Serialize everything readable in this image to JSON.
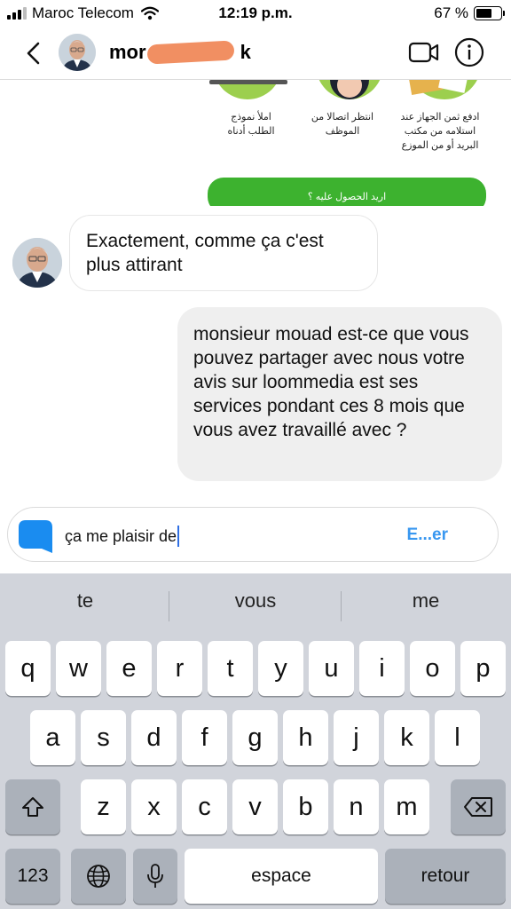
{
  "status_bar": {
    "carrier": "Maroc Telecom",
    "time": "12:19 p.m.",
    "battery": "67 %",
    "battery_level": 0.67
  },
  "header": {
    "username": "mor",
    "username_suffix": "k"
  },
  "shared_image": {
    "captions": [
      "ادفع ثمن الجهاز عند استلامه من مكتب البريد أو من الموزع",
      "انتظر اتصالا من الموظف",
      "املأ نموذج الطلب أدناه"
    ],
    "cta": "اريد الحصول عليه ؟"
  },
  "messages": [
    {
      "direction": "incoming",
      "text": "Exactement, comme ça c'est plus attirant"
    },
    {
      "direction": "outgoing",
      "text": "monsieur mouad est-ce que vous pouvez partager avec nous votre avis sur loommedia est ses services pondant ces 8 mois que vous avez travaillé avec ?"
    }
  ],
  "composer": {
    "value": "ça me plaisir de",
    "send_label": "E...er"
  },
  "keyboard": {
    "suggestions": [
      "te",
      "vous",
      "me"
    ],
    "row1": [
      "q",
      "w",
      "e",
      "r",
      "t",
      "y",
      "u",
      "i",
      "o",
      "p"
    ],
    "row2": [
      "a",
      "s",
      "d",
      "f",
      "g",
      "h",
      "j",
      "k",
      "l"
    ],
    "row3": [
      "z",
      "x",
      "c",
      "v",
      "b",
      "n",
      "m"
    ],
    "numbers_label": "123",
    "space_label": "espace",
    "return_label": "retour"
  },
  "icons": {
    "back": "chevron-left-icon",
    "video": "video-camera-icon",
    "info": "info-icon",
    "camera": "camera-icon",
    "shift": "shift-icon",
    "delete": "backspace-icon",
    "globe": "globe-icon",
    "mic": "microphone-icon"
  },
  "colors": {
    "accent": "#3897f0",
    "camera_button": "#1a8cf0",
    "cta_green": "#3db22f",
    "redaction": "#f0895a"
  }
}
